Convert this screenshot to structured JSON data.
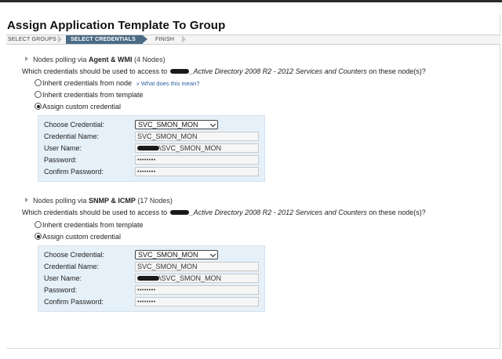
{
  "page_title": "Assign Application Template To Group",
  "wizard": {
    "steps": [
      "SELECT GROUPS",
      "SELECT CREDENTIALS",
      "FINISH"
    ],
    "active_step": "SELECT CREDENTIALS"
  },
  "sections": [
    {
      "heading_prefix": "Nodes polling via ",
      "heading_bold": "Agent & WMI",
      "heading_suffix": " (4 Nodes)",
      "question_prefix": "Which credentials should be used to access to ",
      "question_template": "_Active Directory 2008 R2 - 2012 Services and Counters",
      "question_suffix": " on these node(s)?",
      "options": [
        {
          "label": "Inherit credentials from node",
          "checked": false,
          "help": "» What does this mean?"
        },
        {
          "label": "Inherit credentials from template",
          "checked": false
        },
        {
          "label": "Assign custom credential",
          "checked": true
        }
      ],
      "form": {
        "choose_label": "Choose Credential:",
        "choose_value": "SVC_SMON_MON",
        "name_label": "Credential Name:",
        "name_value": "SVC_SMON_MON",
        "user_label": "User Name:",
        "user_value": "\\SVC_SMON_MON",
        "password_label": "Password:",
        "password_value": "••••••••",
        "confirm_label": "Confirm Password:",
        "confirm_value": "••••••••"
      }
    },
    {
      "heading_prefix": "Nodes polling via ",
      "heading_bold": "SNMP & ICMP",
      "heading_suffix": " (17 Nodes)",
      "question_prefix": "Which credentials should be used to access to ",
      "question_template": "_Active Directory 2008 R2 - 2012 Services and Counters",
      "question_suffix": " on these node(s)?",
      "options": [
        {
          "label": "Inherit credentials from template",
          "checked": false
        },
        {
          "label": "Assign custom credential",
          "checked": true
        }
      ],
      "form": {
        "choose_label": "Choose Credential:",
        "choose_value": "SVC_SMON_MON",
        "name_label": "Credential Name:",
        "name_value": "SVC_SMON_MON",
        "user_label": "User Name:",
        "user_value": "\\SVC_SMON_MON",
        "password_label": "Password:",
        "password_value": "••••••••",
        "confirm_label": "Confirm Password:",
        "confirm_value": "••••••••"
      }
    }
  ],
  "colors": {
    "wizard_active": "#4a6b86",
    "credential_panel": "#e6f0f8",
    "help_link": "#2a5fa0"
  }
}
